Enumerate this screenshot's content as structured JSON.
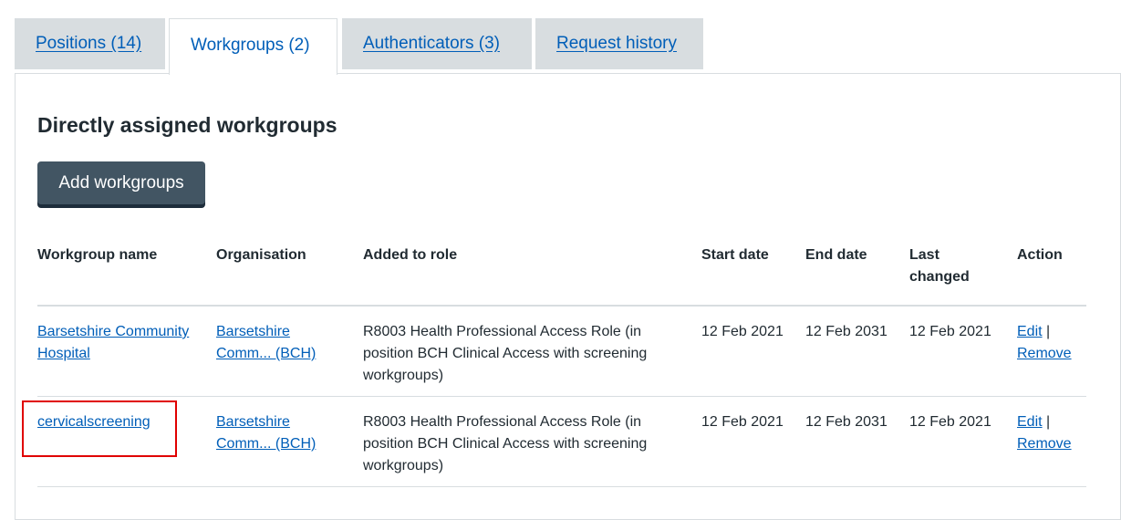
{
  "tabs": [
    {
      "label": "Positions (14)",
      "active": false
    },
    {
      "label": "Workgroups (2)",
      "active": true
    },
    {
      "label": "Authenticators (3)",
      "active": false
    },
    {
      "label": "Request history",
      "active": false
    }
  ],
  "main": {
    "heading": "Directly assigned workgroups",
    "add_button_label": "Add workgroups"
  },
  "table": {
    "headers": {
      "name": "Workgroup name",
      "organisation": "Organisation",
      "added_to_role": "Added to role",
      "start_date": "Start date",
      "end_date": "End date",
      "last_changed": "Last changed",
      "action": "Action"
    },
    "rows": [
      {
        "name": "Barsetshire Community Hospital",
        "organisation": "Barsetshire Comm... (BCH)",
        "added_to_role": "R8003 Health Professional Access Role (in position BCH Clinical Access with screening workgroups)",
        "start_date": "12 Feb 2021",
        "end_date": "12 Feb 2031",
        "last_changed": "12 Feb 2021",
        "edit_label": "Edit",
        "separator": "|",
        "remove_label": "Remove"
      },
      {
        "name": "cervicalscreening",
        "organisation": "Barsetshire Comm... (BCH)",
        "added_to_role": "R8003 Health Professional Access Role (in position BCH Clinical Access with screening workgroups)",
        "start_date": "12 Feb 2021",
        "end_date": "12 Feb 2031",
        "last_changed": "12 Feb 2021",
        "edit_label": "Edit",
        "separator": "|",
        "remove_label": "Remove"
      }
    ]
  },
  "colors": {
    "link": "#005eb8",
    "tab_inactive_bg": "#d8dde0",
    "button_bg": "#425563",
    "highlight": "#e00000"
  }
}
